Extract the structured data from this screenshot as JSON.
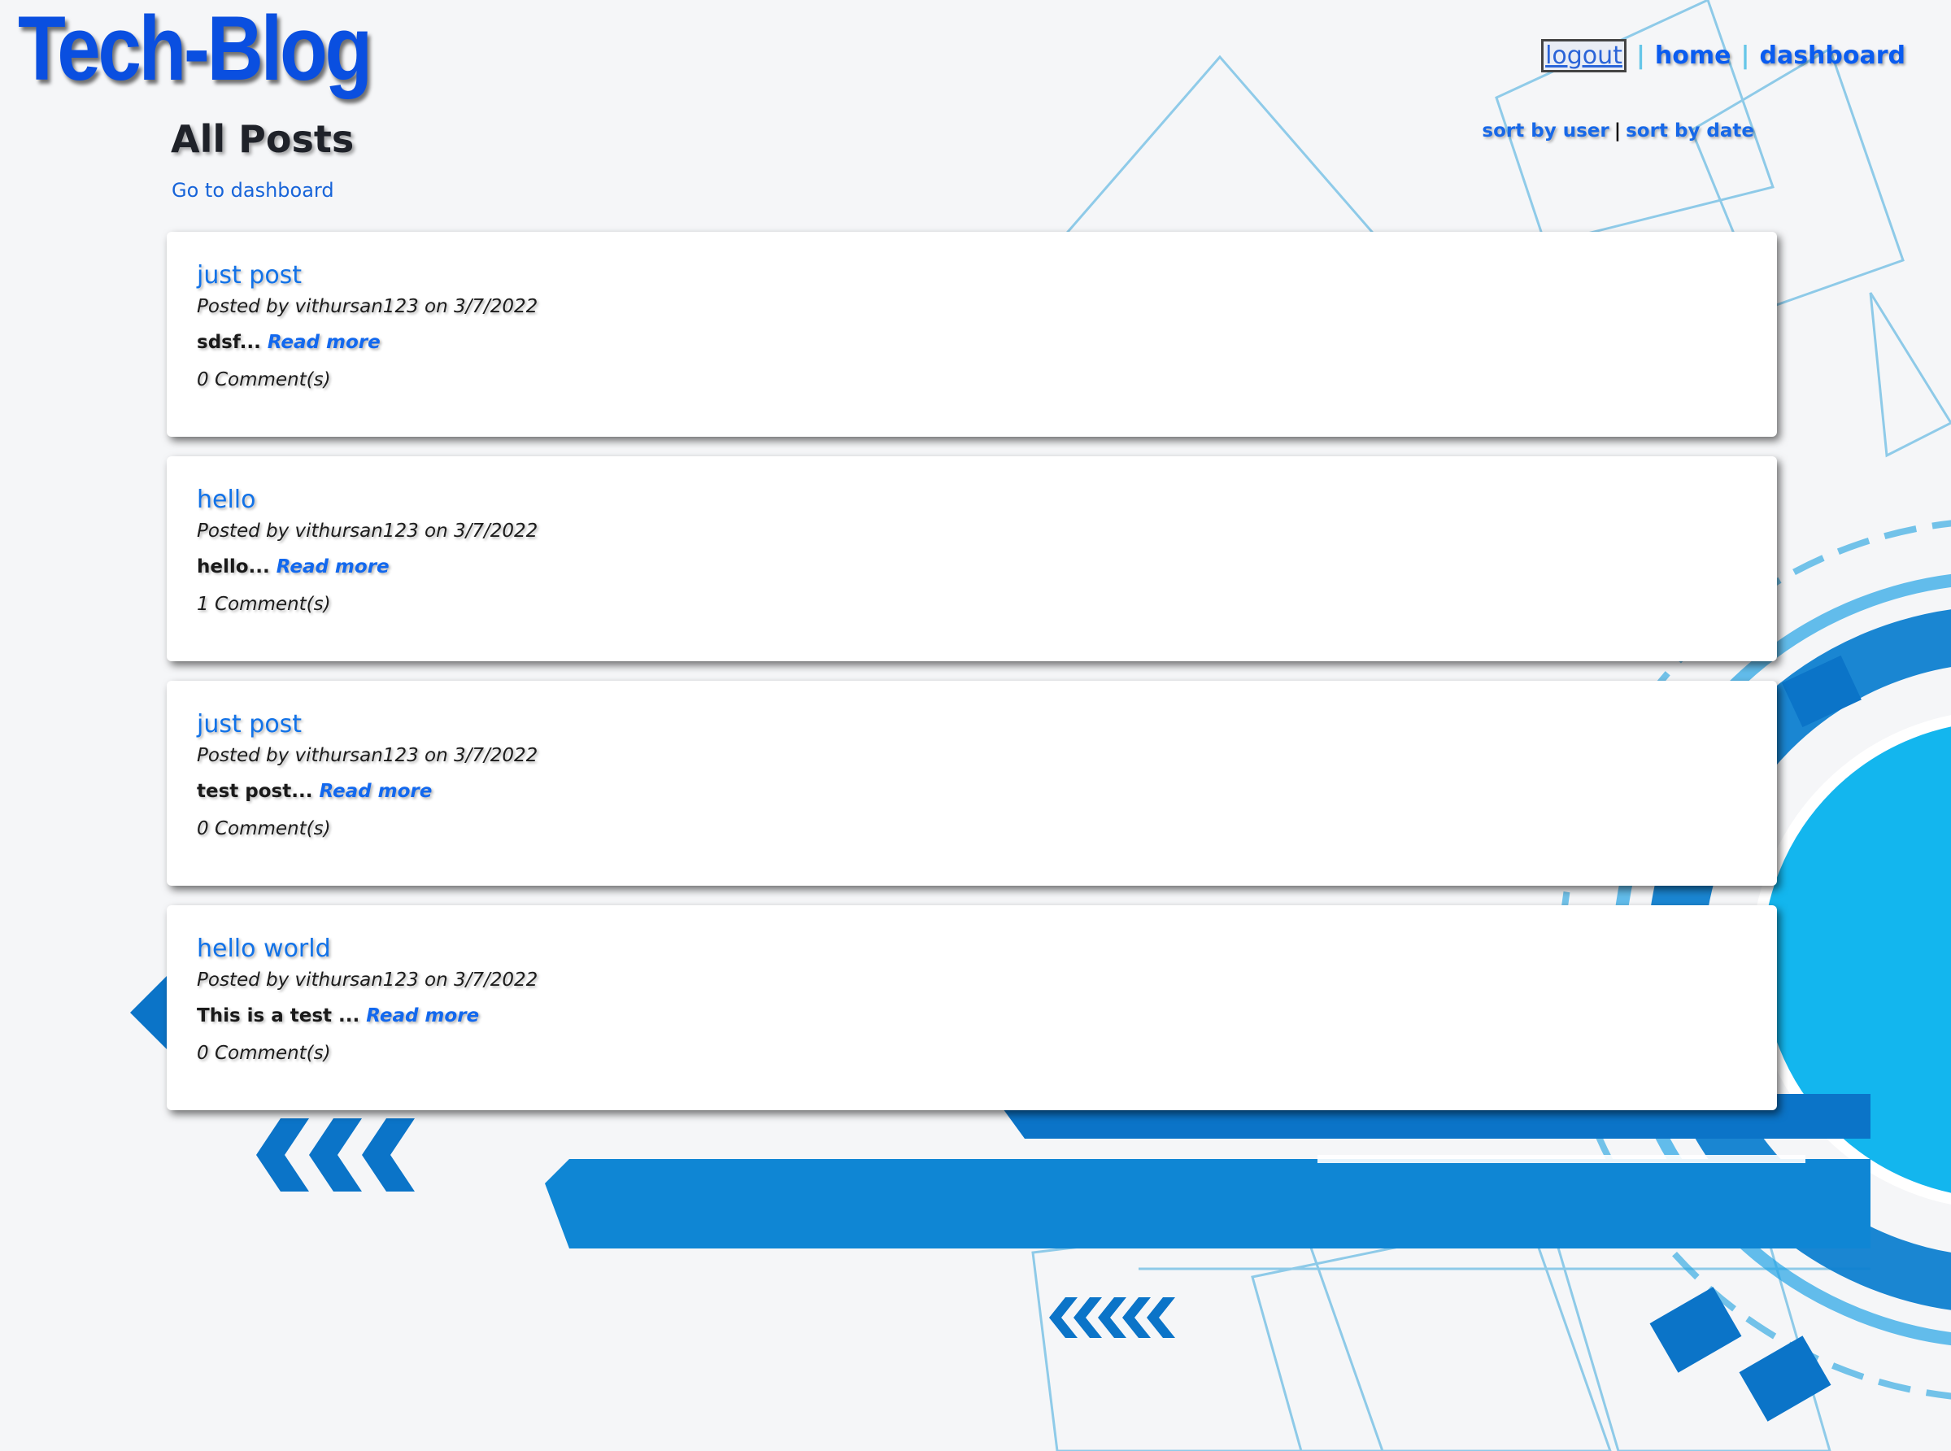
{
  "brand": {
    "logo": "Tech-Blog"
  },
  "nav": {
    "logout": "logout",
    "separator": "|",
    "home": "home",
    "dashboard": "dashboard"
  },
  "page": {
    "title": "All Posts",
    "dashboard_link": "Go to dashboard"
  },
  "sort": {
    "by_user": "sort by user",
    "separator": "|",
    "by_date": "sort by date"
  },
  "posts": [
    {
      "title": "just post",
      "meta": "Posted by vithursan123 on 3/7/2022",
      "excerpt": "sdsf...",
      "read_more": "Read more",
      "comments": "0 Comment(s)"
    },
    {
      "title": "hello",
      "meta": "Posted by vithursan123 on 3/7/2022",
      "excerpt": "hello...",
      "read_more": "Read more",
      "comments": "1 Comment(s)"
    },
    {
      "title": "just post",
      "meta": "Posted by vithursan123 on 3/7/2022",
      "excerpt": "test post...",
      "read_more": "Read more",
      "comments": "0 Comment(s)"
    },
    {
      "title": "hello world",
      "meta": "Posted by vithursan123 on 3/7/2022",
      "excerpt": "This is a test ...",
      "read_more": "Read more",
      "comments": "0 Comment(s)"
    }
  ],
  "colors": {
    "brand": "#0a4fe0",
    "link": "#1172e8",
    "accent_bg": "#0d8fd6"
  }
}
